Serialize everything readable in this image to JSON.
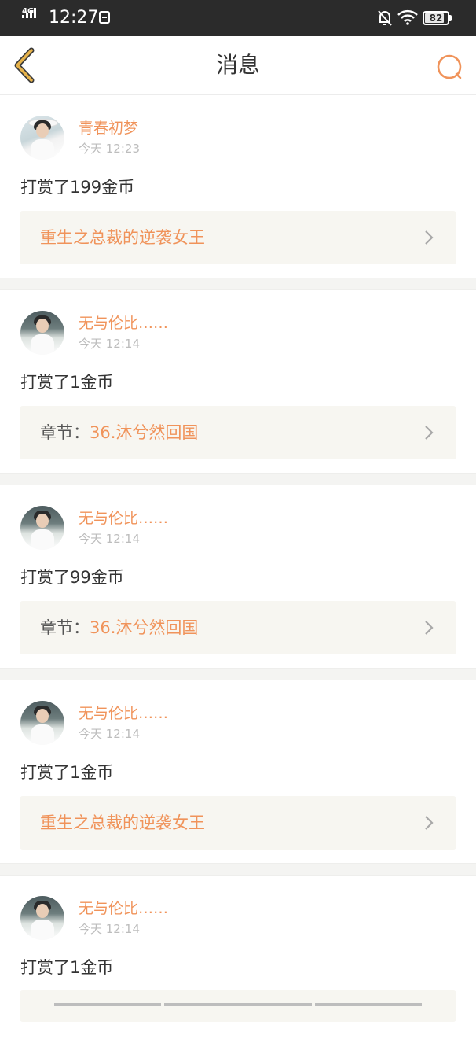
{
  "status_bar": {
    "network": "4G",
    "time": "12:27",
    "battery_level": "82"
  },
  "nav": {
    "title": "消息"
  },
  "colors": {
    "accent": "#f0935a",
    "back_arrow": "#e6b24a",
    "box_bg": "#f7f6f1"
  },
  "messages": [
    {
      "username": "青春初梦",
      "time": "今天 12:23",
      "action": "打赏了199金币",
      "link_prefix": "",
      "link_text": "重生之总裁的逆袭女王",
      "avatar": "girl-white-hat"
    },
    {
      "username": "无与伦比……",
      "time": "今天 12:14",
      "action": "打赏了1金币",
      "link_prefix": "章节：",
      "link_text": "36.沐兮然回国",
      "avatar": "boy-white-shirt"
    },
    {
      "username": "无与伦比……",
      "time": "今天 12:14",
      "action": "打赏了99金币",
      "link_prefix": "章节：",
      "link_text": "36.沐兮然回国",
      "avatar": "boy-white-shirt"
    },
    {
      "username": "无与伦比……",
      "time": "今天 12:14",
      "action": "打赏了1金币",
      "link_prefix": "",
      "link_text": "重生之总裁的逆袭女王",
      "avatar": "boy-white-shirt"
    },
    {
      "username": "无与伦比……",
      "time": "今天 12:14",
      "action": "打赏了1金币",
      "link_prefix": "",
      "link_text": "",
      "avatar": "boy-white-shirt"
    }
  ]
}
